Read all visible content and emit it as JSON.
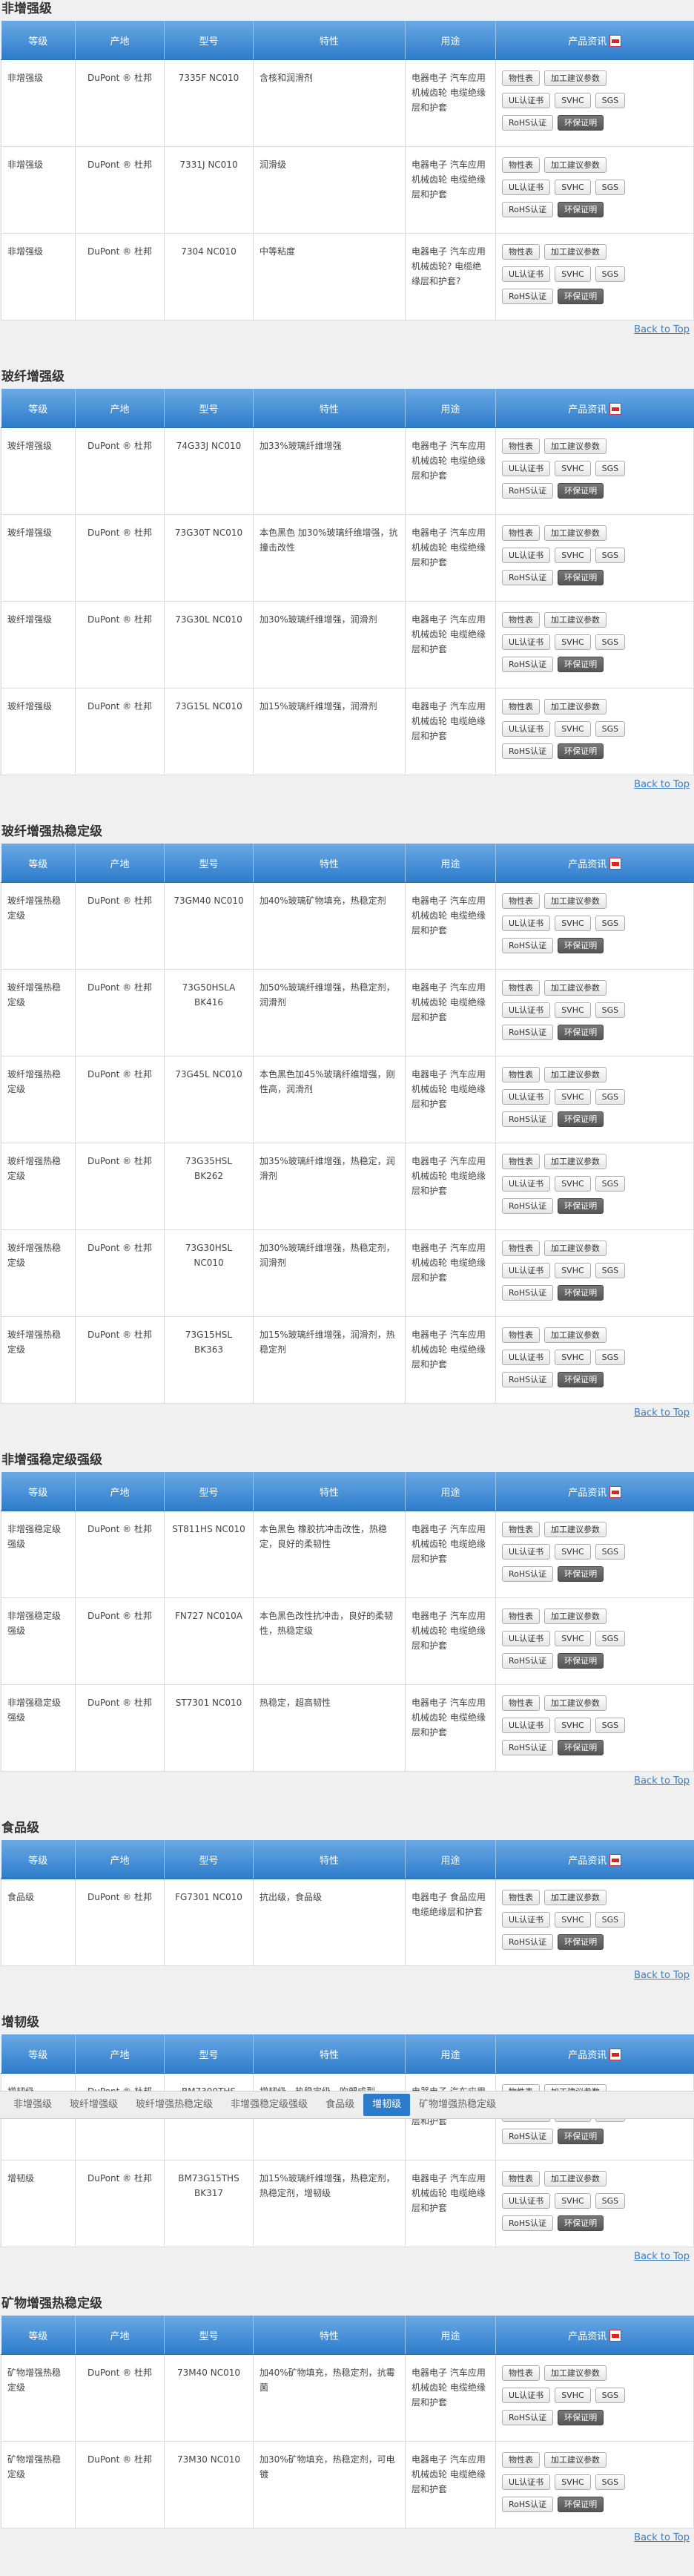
{
  "headers": [
    "等级",
    "产地",
    "型号",
    "特性",
    "用途",
    "产品资讯"
  ],
  "buttons": [
    "物性表",
    "加工建议参数",
    "UL认证书",
    "SVHC",
    "SGS",
    "RoHS认证",
    "环保证明"
  ],
  "back_to_top": "Back to Top",
  "sections": [
    {
      "title": "非增强级",
      "rows": [
        {
          "grade": "非增强级",
          "origin": "DuPont ® 杜邦",
          "model": "7335F NC010",
          "props": "含核和润滑剂",
          "use": "电器电子 汽车应用 机械齿轮 电缆绝缘层和护套"
        },
        {
          "grade": "非增强级",
          "origin": "DuPont ® 杜邦",
          "model": "7331J NC010",
          "props": "润滑级",
          "use": "电器电子 汽车应用 机械齿轮 电缆绝缘层和护套"
        },
        {
          "grade": "非增强级",
          "origin": "DuPont ® 杜邦",
          "model": "7304 NC010",
          "props": "中等粘度",
          "use": "电器电子 汽车应用 机械齿轮? 电缆绝缘层和护套?"
        }
      ]
    },
    {
      "title": "玻纤增强级",
      "rows": [
        {
          "grade": "玻纤增强级",
          "origin": "DuPont ® 杜邦",
          "model": "74G33J NC010",
          "props": "加33%玻璃纤维增强",
          "use": "电器电子 汽车应用 机械齿轮 电缆绝缘层和护套"
        },
        {
          "grade": "玻纤增强级",
          "origin": "DuPont ® 杜邦",
          "model": "73G30T NC010",
          "props": "本色黑色 加30%玻璃纤维增强，抗撞击改性",
          "use": "电器电子 汽车应用 机械齿轮 电缆绝缘层和护套"
        },
        {
          "grade": "玻纤增强级",
          "origin": "DuPont ® 杜邦",
          "model": "73G30L NC010",
          "props": "加30%玻璃纤维增强，润滑剂",
          "use": "电器电子 汽车应用 机械齿轮 电缆绝缘层和护套"
        },
        {
          "grade": "玻纤增强级",
          "origin": "DuPont ® 杜邦",
          "model": "73G15L NC010",
          "props": "加15%玻璃纤维增强，润滑剂",
          "use": "电器电子 汽车应用 机械齿轮 电缆绝缘层和护套"
        }
      ]
    },
    {
      "title": "玻纤增强热稳定级",
      "rows": [
        {
          "grade": "玻纤增强热稳定级",
          "origin": "DuPont ® 杜邦",
          "model": "73GM40 NC010",
          "props": "加40%玻璃矿物填充，热稳定剂",
          "use": "电器电子 汽车应用 机械齿轮 电缆绝缘层和护套"
        },
        {
          "grade": "玻纤增强热稳定级",
          "origin": "DuPont ® 杜邦",
          "model": "73G50HSLA BK416",
          "props": "加50%玻璃纤维增强，热稳定剂，润滑剂",
          "use": "电器电子 汽车应用 机械齿轮 电缆绝缘层和护套"
        },
        {
          "grade": "玻纤增强热稳定级",
          "origin": "DuPont ® 杜邦",
          "model": "73G45L NC010",
          "props": "本色黑色加45%玻璃纤维增强，刚性高，润滑剂",
          "use": "电器电子 汽车应用 机械齿轮 电缆绝缘层和护套"
        },
        {
          "grade": "玻纤增强热稳定级",
          "origin": "DuPont ® 杜邦",
          "model": "73G35HSL BK262",
          "props": "加35%玻璃纤维增强，热稳定，润滑剂",
          "use": "电器电子 汽车应用 机械齿轮 电缆绝缘层和护套"
        },
        {
          "grade": "玻纤增强热稳定级",
          "origin": "DuPont ® 杜邦",
          "model": "73G30HSL NC010",
          "props": "加30%玻璃纤维增强，热稳定剂，润滑剂",
          "use": "电器电子 汽车应用 机械齿轮 电缆绝缘层和护套"
        },
        {
          "grade": "玻纤增强热稳定级",
          "origin": "DuPont ® 杜邦",
          "model": "73G15HSL BK363",
          "props": "加15%玻璃纤维增强，润滑剂，热稳定剂",
          "use": "电器电子 汽车应用 机械齿轮 电缆绝缘层和护套"
        }
      ]
    },
    {
      "title": "非增强稳定级强级",
      "rows": [
        {
          "grade": "非增强稳定级强级",
          "origin": "DuPont ® 杜邦",
          "model": "ST811HS NC010",
          "props": "本色黑色 橡胶抗冲击改性，热稳定，良好的柔韧性",
          "use": "电器电子 汽车应用 机械齿轮 电缆绝缘层和护套"
        },
        {
          "grade": "非增强稳定级强级",
          "origin": "DuPont ® 杜邦",
          "model": "FN727 NC010A",
          "props": "本色黑色改性抗冲击，良好的柔韧性，热稳定级",
          "use": "电器电子 汽车应用 机械齿轮 电缆绝缘层和护套"
        },
        {
          "grade": "非增强稳定级强级",
          "origin": "DuPont ® 杜邦",
          "model": "ST7301 NC010",
          "props": "热稳定，超高韧性",
          "use": "电器电子 汽车应用 机械齿轮 电缆绝缘层和护套"
        }
      ]
    },
    {
      "title": "食品级",
      "rows": [
        {
          "grade": "食品级",
          "origin": "DuPont ® 杜邦",
          "model": "FG7301 NC010",
          "props": "抗出级，食品级",
          "use": "电器电子 食品应用 电缆绝缘层和护套"
        }
      ]
    },
    {
      "title": "增韧级",
      "rows": [
        {
          "grade": "增韧级",
          "origin": "DuPont ® 杜邦",
          "model": "BM7300THS BK317",
          "props": "增韧级，热稳定级，吹塑成型",
          "use": "电器电子 汽车应用 机械齿轮 电缆绝缘层和护套"
        },
        {
          "grade": "增韧级",
          "origin": "DuPont ® 杜邦",
          "model": "BM73G15THS BK317",
          "props": "加15%玻璃纤维增强，热稳定剂，热稳定剂，增韧级",
          "use": "电器电子 汽车应用 机械齿轮 电缆绝缘层和护套"
        }
      ]
    },
    {
      "title": "矿物增强热稳定级",
      "rows": [
        {
          "grade": "矿物增强热稳定级",
          "origin": "DuPont ® 杜邦",
          "model": "73M40 NC010",
          "props": "加40%矿物填充，热稳定剂，抗霉菌",
          "use": "电器电子 汽车应用 机械齿轮 电缆绝缘层和护套"
        },
        {
          "grade": "矿物增强热稳定级",
          "origin": "DuPont ® 杜邦",
          "model": "73M30 NC010",
          "props": "加30%矿物填充，热稳定剂，可电镀",
          "use": "电器电子 汽车应用 机械齿轮 电缆绝缘层和护套"
        }
      ]
    }
  ],
  "tabs": [
    {
      "label": "非增强级",
      "active": false
    },
    {
      "label": "玻纤增强级",
      "active": false
    },
    {
      "label": "玻纤增强热稳定级",
      "active": false
    },
    {
      "label": "非增强稳定级强级",
      "active": false
    },
    {
      "label": "食品级",
      "active": false
    },
    {
      "label": "增韧级",
      "active": true
    },
    {
      "label": "矿物增强热稳定级",
      "active": false
    }
  ],
  "colors": {
    "header_blue": "#2d7ccb",
    "link_blue": "#3b7fc4",
    "env_button": "#555555"
  },
  "icons": {
    "product_info_header": "pdf-icon"
  }
}
